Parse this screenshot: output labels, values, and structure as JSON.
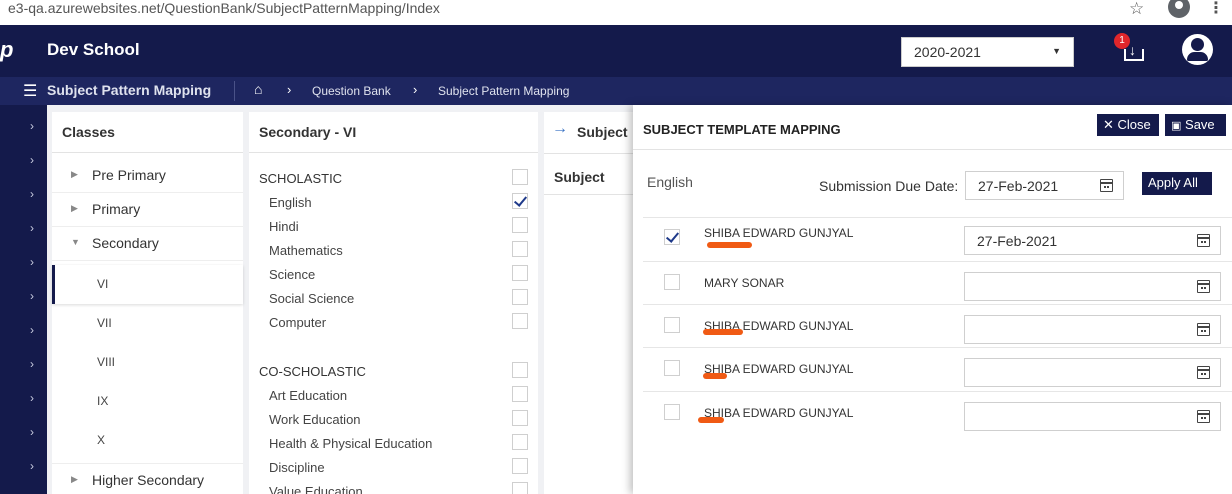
{
  "browser": {
    "url": "e3-qa.azurewebsites.net/QuestionBank/SubjectPatternMapping/Index"
  },
  "header": {
    "logo_text": "p",
    "school_name": "Dev School",
    "year": "2020-2021",
    "download_badge": "1"
  },
  "breadcrumb": {
    "page_title": "Subject Pattern Mapping",
    "items": [
      "Question Bank",
      "Subject Pattern Mapping"
    ]
  },
  "classes": {
    "title": "Classes",
    "items": [
      {
        "label": "Pre Primary",
        "expanded": false
      },
      {
        "label": "Primary",
        "expanded": false
      },
      {
        "label": "Secondary",
        "expanded": true
      },
      {
        "label": "Higher Secondary",
        "expanded": false
      }
    ],
    "sub_items": [
      "VI",
      "VII",
      "VIII",
      "IX",
      "X"
    ],
    "active_sub": "VI"
  },
  "subjects": {
    "title": "Secondary - VI",
    "groups": [
      {
        "name": "SCHOLASTIC",
        "items": [
          {
            "label": "English",
            "checked": true
          },
          {
            "label": "Hindi",
            "checked": false
          },
          {
            "label": "Mathematics",
            "checked": false
          },
          {
            "label": "Science",
            "checked": false
          },
          {
            "label": "Social Science",
            "checked": false
          },
          {
            "label": "Computer",
            "checked": false
          }
        ]
      },
      {
        "name": "CO-SCHOLASTIC",
        "items": [
          {
            "label": "Art Education",
            "checked": false
          },
          {
            "label": "Work Education",
            "checked": false
          },
          {
            "label": "Health & Physical Education",
            "checked": false
          },
          {
            "label": "Discipline",
            "checked": false
          },
          {
            "label": "Value Education",
            "checked": false
          }
        ]
      }
    ]
  },
  "subject_panel": {
    "title": "Subject",
    "column": "Subject"
  },
  "drawer": {
    "title": "SUBJECT TEMPLATE MAPPING",
    "close_label": "Close",
    "save_label": "Save",
    "subject": "English",
    "due_label": "Submission Due Date:",
    "due_value": "27-Feb-2021",
    "apply_label": "Apply All",
    "students": [
      {
        "name": "SHIBA EDWARD GUNJYAL",
        "checked": true,
        "date": "27-Feb-2021"
      },
      {
        "name": "MARY SONAR",
        "checked": false,
        "date": ""
      },
      {
        "name": "SHIBA EDWARD GUNJYAL",
        "checked": false,
        "date": ""
      },
      {
        "name": "SHIBA EDWARD GUNJYAL",
        "checked": false,
        "date": ""
      },
      {
        "name": "SHIBA EDWARD GUNJYAL",
        "checked": false,
        "date": ""
      }
    ]
  },
  "colors": {
    "nav_dark": "#141a4b",
    "crumb_bar": "#1e2660",
    "redaction": "#f05a14",
    "badge": "#e0262b"
  }
}
